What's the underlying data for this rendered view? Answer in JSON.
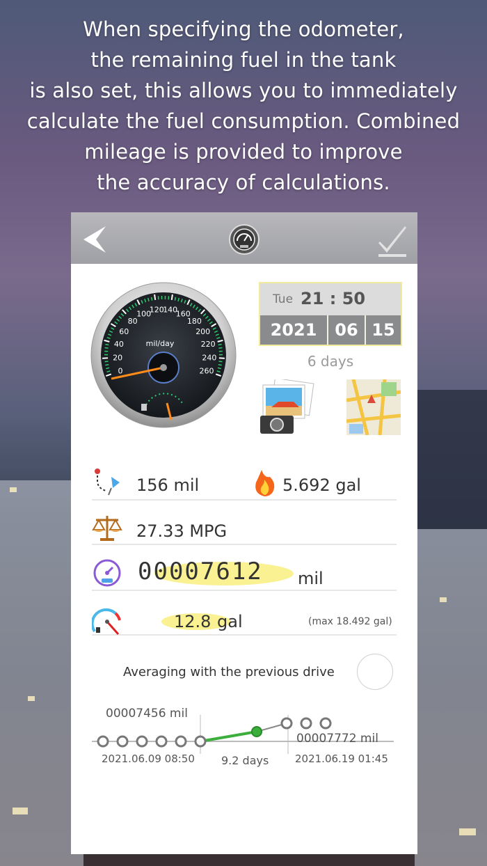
{
  "headline": {
    "line1": "When specifying the odometer,",
    "line2": "the remaining fuel in the tank",
    "line3": "is also set, this allows you to immediately",
    "line4": "calculate the fuel consumption. Combined",
    "line5": "mileage is provided to improve",
    "line6": "the accuracy of calculations."
  },
  "gauge": {
    "unit": "mil/day",
    "ticks": [
      "0",
      "20",
      "40",
      "60",
      "80",
      "100",
      "120",
      "140",
      "160",
      "180",
      "200",
      "220",
      "240",
      "260"
    ]
  },
  "datetime": {
    "weekday": "Tue",
    "time": "21 : 50",
    "year": "2021",
    "month": "06",
    "day": "15",
    "elapsed": "6 days"
  },
  "stats": {
    "distance": "156 mil",
    "fuel_used": "5.692 gal",
    "economy": "27.33 MPG",
    "odometer_value": "00007612",
    "odometer_unit": "mil",
    "fuel_level": "12.8",
    "fuel_unit": "gal",
    "fuel_max": "(max 18.492 gal)"
  },
  "averaging": {
    "label": "Averaging with the previous drive"
  },
  "timeline": {
    "prev_odometer": "00007456 mil",
    "prev_date": "2021.06.09 08:50",
    "interval": "9.2 days",
    "next_odometer": "00007772 mil",
    "next_date": "2021.06.19 01:45"
  },
  "colors": {
    "accent_green": "#3cae3c",
    "highlight_yellow": "#f8ec6e",
    "topbar_gray": "#a8a9ad"
  },
  "icons": {
    "back": "back-arrow-icon",
    "confirm": "checkmark-icon",
    "logo": "speedometer-logo-icon",
    "distance": "map-pin-route-icon",
    "fuel_used": "flame-icon",
    "economy": "scales-icon",
    "odometer": "odometer-dial-icon",
    "fuel_level": "fuel-gauge-icon",
    "photo": "camera-photos-icon",
    "map": "map-thumbnail-icon"
  }
}
